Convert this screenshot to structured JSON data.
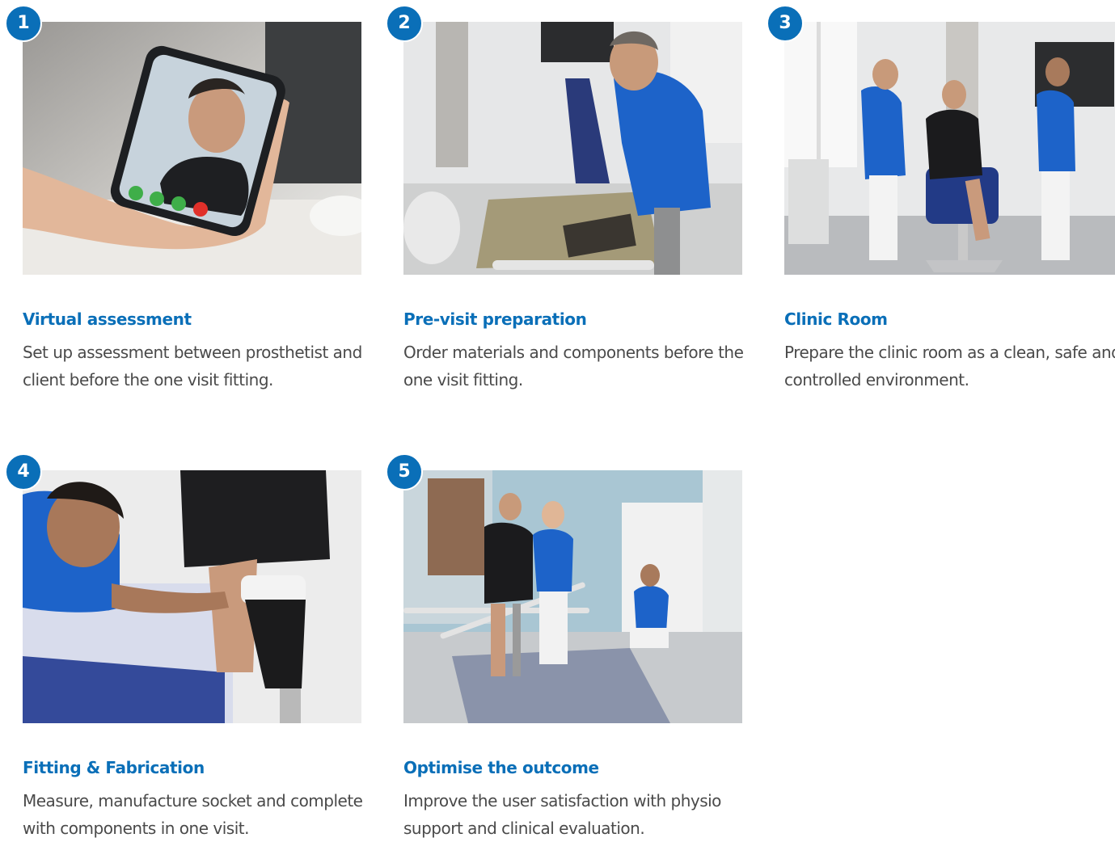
{
  "steps": [
    {
      "number": "1",
      "title": "Virtual assessment",
      "description": "Set up assessment between prosthetist and client before the one visit fitting.",
      "photo_alt": "video-call-photo"
    },
    {
      "number": "2",
      "title": "Pre-visit preparation",
      "description": "Order materials and components before the one visit fitting.",
      "photo_alt": "workshop-preparation-photo"
    },
    {
      "number": "3",
      "title": "Clinic Room",
      "description": "Prepare the clinic room as a clean, safe and controlled environment.",
      "photo_alt": "clinic-room-photo"
    },
    {
      "number": "4",
      "title": "Fitting & Fabrication",
      "description": "Measure, manufacture socket and complete with components in one visit.",
      "photo_alt": "socket-fitting-photo"
    },
    {
      "number": "5",
      "title": "Optimise the outcome",
      "description": "Improve the user satisfaction with physio support and clinical evaluation.",
      "photo_alt": "physio-walking-photo"
    }
  ],
  "colors": {
    "brand_blue": "#0a6fb8",
    "body_text": "#4a4a4a",
    "shirt_blue": "#1d63c9"
  }
}
